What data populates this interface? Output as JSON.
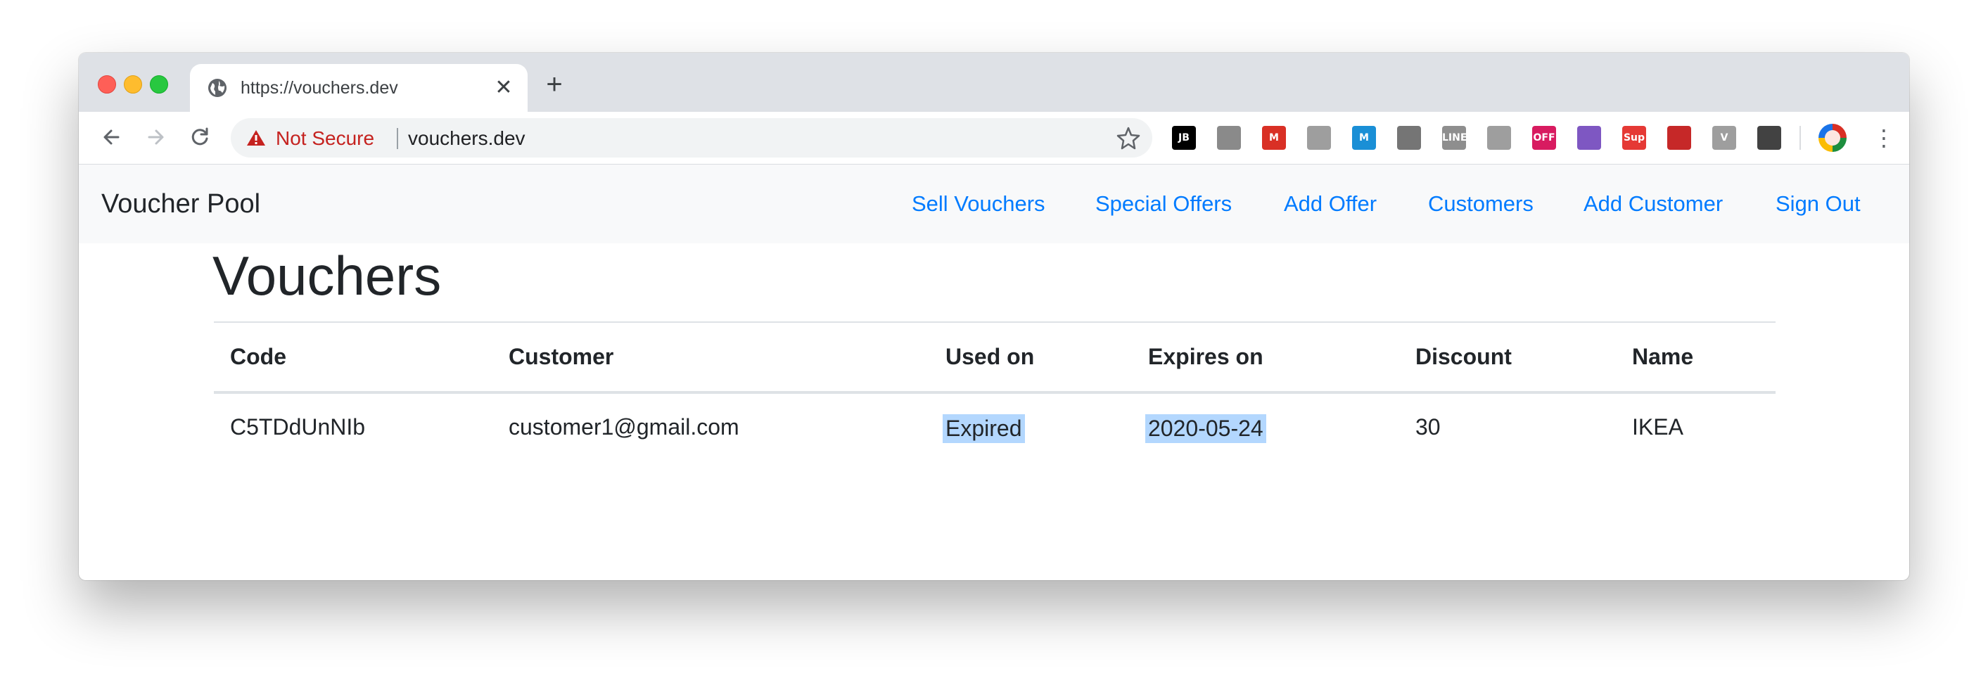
{
  "browser": {
    "tab_title": "https://vouchers.dev",
    "tab_close": "✕",
    "new_tab": "+",
    "security_label": "Not Secure",
    "address": "vouchers.dev",
    "menu": "⋮",
    "extensions": [
      {
        "icon": "jetbrains-icon",
        "text": "JB",
        "color": "#000000"
      },
      {
        "icon": "gear-extension-icon",
        "text": "",
        "color": "#8a8a8a"
      },
      {
        "icon": "m-red-circle-icon",
        "text": "M",
        "color": "#d93025"
      },
      {
        "icon": "cube-icon",
        "text": "",
        "color": "#9e9e9e"
      },
      {
        "icon": "m-blue-square-icon",
        "text": "M",
        "color": "#1a8fd6"
      },
      {
        "icon": "link-icon",
        "text": "",
        "color": "#757575"
      },
      {
        "icon": "line-icon",
        "text": "LINE",
        "color": "#8e8e8e"
      },
      {
        "icon": "download-arrow-icon",
        "text": "",
        "color": "#9e9e9e"
      },
      {
        "icon": "off-icon",
        "text": "OFF",
        "color": "#d81b60"
      },
      {
        "icon": "screenshot-icon",
        "text": "",
        "color": "#7e57c2"
      },
      {
        "icon": "supreme-icon",
        "text": "Sup",
        "color": "#e53935"
      },
      {
        "icon": "red-square-icon",
        "text": "",
        "color": "#c62828"
      },
      {
        "icon": "v-icon",
        "text": "V",
        "color": "#9e9e9e"
      },
      {
        "icon": "download-box-icon",
        "text": "",
        "color": "#424242"
      }
    ]
  },
  "app": {
    "brand": "Voucher Pool",
    "nav": [
      "Sell Vouchers",
      "Special Offers",
      "Add Offer",
      "Customers",
      "Add Customer",
      "Sign Out"
    ],
    "link_color": "#007bff"
  },
  "page": {
    "title": "Vouchers",
    "columns": [
      "Code",
      "Customer",
      "Used on",
      "Expires on",
      "Discount",
      "Name"
    ],
    "rows": [
      {
        "code": "C5TDdUnNIb",
        "customer": "customer1@gmail.com",
        "used_on": "Expired",
        "expires_on": "2020-05-24",
        "discount": "30",
        "name": "IKEA"
      }
    ]
  }
}
